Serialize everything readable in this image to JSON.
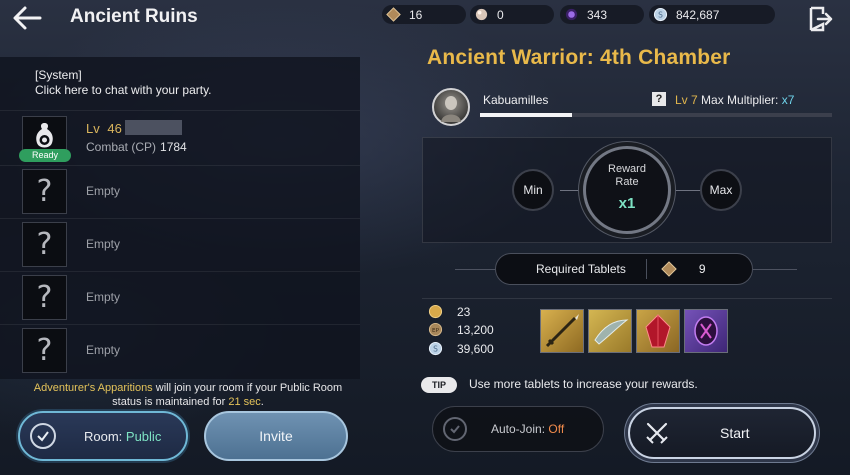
{
  "header": {
    "title": "Ancient Ruins",
    "currencies": [
      {
        "icon": "tablet-icon",
        "value": "16"
      },
      {
        "icon": "pearl-icon",
        "value": "0"
      },
      {
        "icon": "purple-gem-icon",
        "value": "343"
      },
      {
        "icon": "silver-coin-icon",
        "value": "842,687"
      }
    ]
  },
  "party": {
    "chat": {
      "system_label": "[System]",
      "hint": "Click here to chat with your party."
    },
    "leader": {
      "level_prefix": "Lv",
      "level": "46",
      "ready_label": "Ready",
      "cp_label": "Combat (CP)",
      "cp_value": "1784"
    },
    "empty_label": "Empty",
    "notice": {
      "highlight": "Adventurer's Apparitions",
      "line1_rest": " will join your room if your Public Room",
      "line2_prefix": "status is maintained for ",
      "seconds": "21 sec",
      "line2_suffix": "."
    },
    "room_label": "Room: ",
    "room_value": "Public",
    "invite_label": "Invite"
  },
  "dungeon": {
    "title": "Ancient Warrior: 4th Chamber",
    "boss_name": "Kabuamilles",
    "hint_icon": "?",
    "level_label": "Lv 7",
    "max_mult_label": "Max Multiplier:",
    "max_mult_value": "x7",
    "progress": 0.26
  },
  "reward_rate": {
    "min_label": "Min",
    "max_label": "Max",
    "center_line1": "Reward",
    "center_line2": "Rate",
    "multiplier": "x1"
  },
  "tablets": {
    "label": "Required Tablets",
    "value": "9"
  },
  "rewards": [
    {
      "icon": "gold-coin-icon",
      "value": "23"
    },
    {
      "icon": "exp-coin-icon",
      "value": "13,200"
    },
    {
      "icon": "silver-coin-icon",
      "value": "39,600"
    }
  ],
  "reward_items": [
    {
      "name": "spear-item-icon",
      "bg": "#c09a3a"
    },
    {
      "name": "blade-item-icon",
      "bg": "#c4a23c"
    },
    {
      "name": "red-crystal-item-icon",
      "bg": "#b8903a"
    },
    {
      "name": "purple-rune-item-icon",
      "bg": "#6a4aa8"
    }
  ],
  "tip": {
    "badge": "TIP",
    "text": "Use more tablets to increase your rewards."
  },
  "auto_join": {
    "label": "Auto-Join: ",
    "value": "Off"
  },
  "start_label": "Start",
  "colors": {
    "accent_gold": "#e9b94a",
    "accent_teal": "#7ee3c4",
    "ready_green": "#2f9e5e",
    "off_orange": "#f08a4b"
  }
}
